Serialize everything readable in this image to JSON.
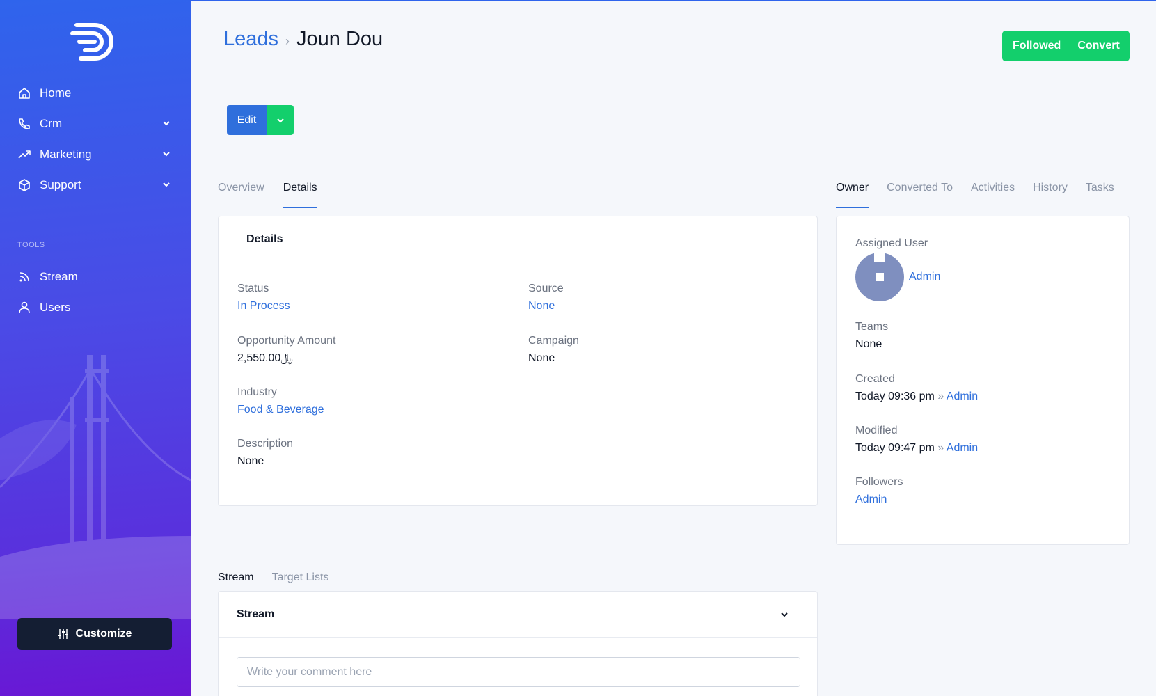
{
  "sidebar": {
    "nav": [
      {
        "label": "Home",
        "icon": "home-icon",
        "has_children": false
      },
      {
        "label": "Crm",
        "icon": "phone-icon",
        "has_children": true
      },
      {
        "label": "Marketing",
        "icon": "trending-up-icon",
        "has_children": true
      },
      {
        "label": "Support",
        "icon": "box-icon",
        "has_children": true
      }
    ],
    "tools_label": "TOOLS",
    "tools": [
      {
        "label": "Stream",
        "icon": "rss-icon"
      },
      {
        "label": "Users",
        "icon": "user-icon"
      }
    ],
    "customize_label": "Customize"
  },
  "header": {
    "breadcrumb_parent": "Leads",
    "breadcrumb_separator": "›",
    "record_name": "Joun Dou",
    "followed_label": "Followed",
    "convert_label": "Convert"
  },
  "actions": {
    "edit_label": "Edit"
  },
  "main_tabs": [
    {
      "label": "Overview",
      "active": false
    },
    {
      "label": "Details",
      "active": true
    }
  ],
  "details": {
    "title": "Details",
    "status": {
      "label": "Status",
      "value": "In Process"
    },
    "source": {
      "label": "Source",
      "value": "None"
    },
    "opportunity_amount": {
      "label": "Opportunity Amount",
      "value": "2,550.00﷼"
    },
    "campaign": {
      "label": "Campaign",
      "value": "None"
    },
    "industry": {
      "label": "Industry",
      "value": "Food & Beverage"
    },
    "description": {
      "label": "Description",
      "value": "None"
    }
  },
  "side_tabs": [
    {
      "label": "Owner",
      "active": true
    },
    {
      "label": "Converted To",
      "active": false
    },
    {
      "label": "Activities",
      "active": false
    },
    {
      "label": "History",
      "active": false
    },
    {
      "label": "Tasks",
      "active": false
    }
  ],
  "owner": {
    "assigned_user_label": "Assigned User",
    "assigned_user": "Admin",
    "teams_label": "Teams",
    "teams": "None",
    "created_label": "Created",
    "created_time": "Today 09:36 pm",
    "created_by": "Admin",
    "modified_label": "Modified",
    "modified_time": "Today 09:47 pm",
    "modified_by": "Admin",
    "by_separator": "»",
    "followers_label": "Followers",
    "followers": "Admin"
  },
  "bottom_tabs": [
    {
      "label": "Stream",
      "active": true
    },
    {
      "label": "Target Lists",
      "active": false
    }
  ],
  "stream": {
    "title": "Stream",
    "comment_placeholder": "Write your comment here"
  },
  "colors": {
    "accent": "#2f6fdc",
    "success": "#13cf6c",
    "sidebar_top": "#2f64ec",
    "sidebar_bottom": "#6a16d4",
    "dark_button": "#141e33"
  }
}
